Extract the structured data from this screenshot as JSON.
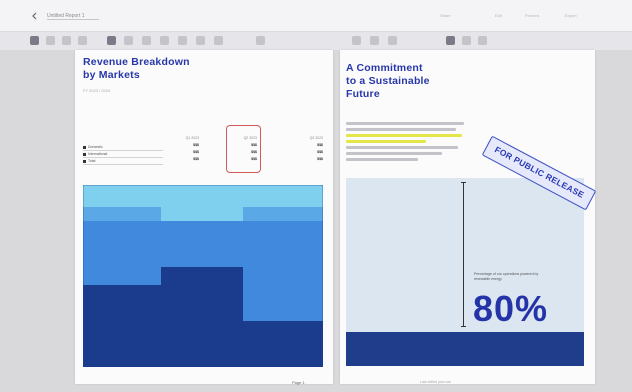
{
  "window": {
    "doc_title": "Untitled Report 1",
    "right_items": [
      "Share",
      "Edit",
      "Present",
      "Export"
    ]
  },
  "toolbar": {
    "tools": [
      "select-tool",
      "text-tool",
      "pen-tool",
      "shape-tool",
      "image-tool",
      "table-tool",
      "chart-tool",
      "comment-tool",
      "undo-tool",
      "redo-tool",
      "align-tool",
      "grid-tool"
    ]
  },
  "left_page": {
    "heading_line1": "Revenue Breakdown",
    "heading_line2": "by Markets",
    "subtitle": "FY 2023 / 2024",
    "table": {
      "rows": [
        "Domestic",
        "International",
        "Total"
      ],
      "columns": [
        {
          "head": "Q1 2023",
          "values": [
            "$$$",
            "$$$",
            "$$$"
          ]
        },
        {
          "head": "Q2 2023",
          "values": [
            "$$$",
            "$$$",
            "$$$"
          ]
        },
        {
          "head": "Q3 2023",
          "values": [
            "$$$",
            "$$$",
            "$$$"
          ]
        }
      ]
    },
    "chart_colors": {
      "light": "#5aa8e6",
      "cyan": "#7ed0ee",
      "mid": "#2b6fd4",
      "dark": "#1b3c8c"
    }
  },
  "right_page": {
    "heading_line1": "A Commitment",
    "heading_line2": "to a Sustainable",
    "heading_line3": "Future",
    "caption": "Percentage of our operations powered by renewable energy",
    "stat": "80%",
    "stamp": "FOR PUBLIC RELEASE"
  },
  "footer": {
    "page": "Page 1",
    "meta": "Last edited just now"
  }
}
